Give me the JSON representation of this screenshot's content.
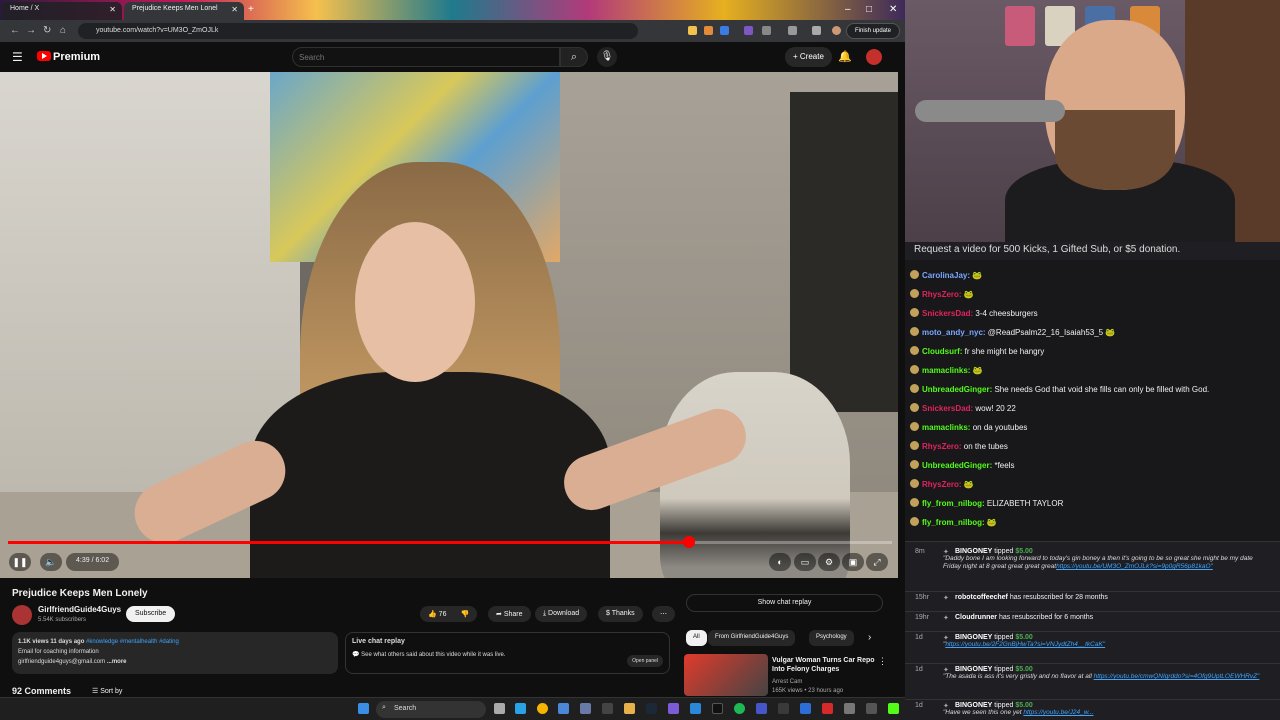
{
  "browser": {
    "tabs": [
      {
        "label": "Home / X"
      },
      {
        "label": "Prejudice Keeps Men Lonel"
      }
    ],
    "url": "youtube.com/watch?v=UM3O_ZmOJLk",
    "finish_update": "Finish update"
  },
  "youtube": {
    "brand": "Premium",
    "search_placeholder": "Search",
    "create_label": "Create",
    "video": {
      "time": "4:39 / 6:02",
      "progress_fraction": 0.77
    },
    "title": "Prejudice Keeps Men Lonely",
    "channel": {
      "name": "GirlfriendGuide4Guys",
      "subscribers": "5.54K subscribers"
    },
    "subscribe_label": "Subscribe",
    "actions": {
      "likes": "76",
      "share": "Share",
      "download": "Download",
      "thanks": "Thanks",
      "more": "⋯"
    },
    "description": {
      "views_date": "1.1K views  11 days ago",
      "tags": "#knowledge #mentalhealth #dating",
      "line2": "Email for coaching information",
      "line3": "girlfriendguide4guys@gmail.com",
      "more": "...more"
    },
    "live_chat": {
      "title": "Live chat replay",
      "text": "See what others said about this video while it was live.",
      "open_panel": "Open panel"
    },
    "comments": {
      "count": "92 Comments",
      "sort": "Sort by"
    },
    "show_chat_replay": "Show chat replay",
    "chips": [
      "All",
      "From GirlfriendGuide4Guys",
      "Psychology"
    ],
    "recommended": {
      "title": "Vulgar Woman Turns Car Repo Into Felony Charges",
      "channel": "Arrest Cam",
      "meta": "165K views • 23 hours ago"
    }
  },
  "taskbar": {
    "search": "Search"
  },
  "stream": {
    "request_bar": "Request a video for 500 Kicks, 1 Gifted Sub, or $5 donation.",
    "chat": [
      {
        "user": "CarolinaJay:",
        "color": "#7aa7ff",
        "text": "",
        "emote": true
      },
      {
        "user": "RhysZero:",
        "color": "#e0245e",
        "text": "",
        "emote": true
      },
      {
        "user": "SnickersDad:",
        "color": "#e0245e",
        "text": "3-4 cheesburgers"
      },
      {
        "user": "moto_andy_nyc:",
        "color": "#7aa7ff",
        "text": "@ReadPsalm22_16_Isaiah53_5",
        "emote": true
      },
      {
        "user": "Cloudsurf:",
        "color": "#53fc18",
        "text": "fr she might be hangry"
      },
      {
        "user": "mamaclinks:",
        "color": "#53fc18",
        "text": "",
        "emote": true
      },
      {
        "user": "UnbreadedGinger:",
        "color": "#53fc18",
        "text": "She needs God that void she fills can only be filled with God."
      },
      {
        "user": "SnickersDad:",
        "color": "#e0245e",
        "text": "wow! 20 22"
      },
      {
        "user": "mamaclinks:",
        "color": "#53fc18",
        "text": "on da youtubes"
      },
      {
        "user": "RhysZero:",
        "color": "#e0245e",
        "text": "on the tubes"
      },
      {
        "user": "UnbreadedGinger:",
        "color": "#53fc18",
        "text": "*feels"
      },
      {
        "user": "RhysZero:",
        "color": "#e0245e",
        "text": "",
        "emote": true
      },
      {
        "user": "fly_from_nilbog:",
        "color": "#53fc18",
        "text": "ELIZABETH TAYLOR"
      },
      {
        "user": "fly_from_nilbog:",
        "color": "#53fc18",
        "text": "",
        "emote": true
      }
    ],
    "events": [
      {
        "ago": "8m",
        "who": "BINGONEY",
        "verb": "tipped",
        "amount": "$5.00",
        "note": "\"Daddy bone I am looking forward to today's gin boney a then it's going to be so great she might be my date Friday night at 8 great great great great",
        "link": "https://youtu.be/UM3O_ZmOJLk?si=9p0gR56p81kaO\""
      },
      {
        "ago": "15hr",
        "who": "robotcoffeechef",
        "verb": "has resubscribed for 28 months"
      },
      {
        "ago": "19hr",
        "who": "Cloudrunner",
        "verb": "has resubscribed for 6 months"
      },
      {
        "ago": "1d",
        "who": "BINGONEY",
        "verb": "tipped",
        "amount": "$5.00",
        "note": "\"",
        "link": "https://youtu.be/2F2GnBjHwTa?si=VNJydtZh4__tkCaK\""
      },
      {
        "ago": "1d",
        "who": "BINGONEY",
        "verb": "tipped",
        "amount": "$5.00",
        "note": "\"The asada is ass it's very gristly and no flavor at all ",
        "link": "https://youtu.be/cmwQNIgrddo?si=4Ofg9UptLOEWHRvZ\""
      },
      {
        "ago": "1d",
        "who": "BINGONEY",
        "verb": "tipped",
        "amount": "$5.00",
        "note": "\"Have we seen this one yet ",
        "link": "https://youtu.be/J24_w..."
      }
    ]
  }
}
